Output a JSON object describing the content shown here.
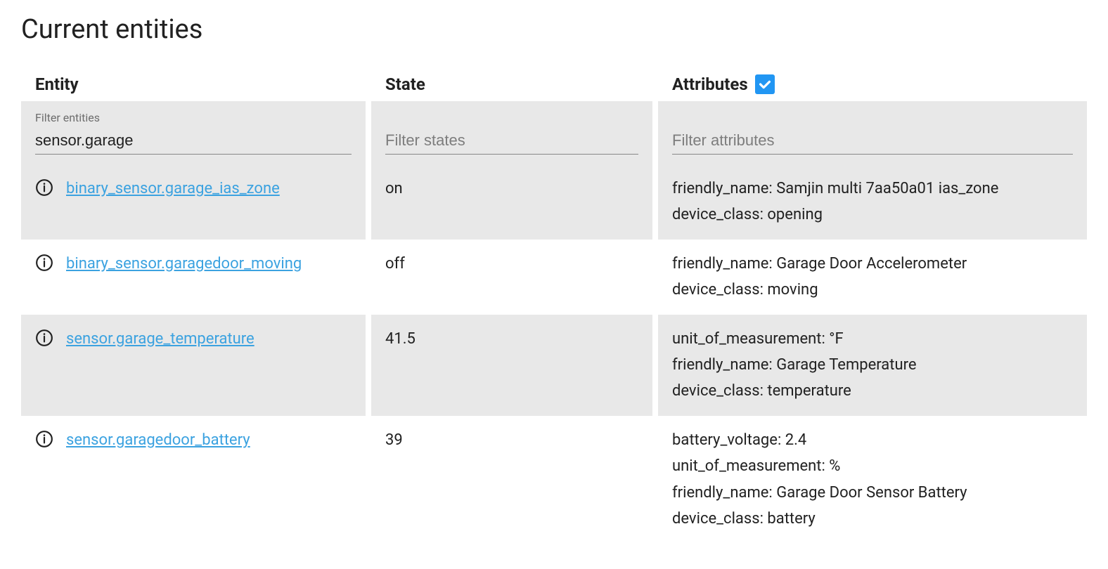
{
  "title": "Current entities",
  "headers": {
    "entity": "Entity",
    "state": "State",
    "attributes": "Attributes"
  },
  "filters": {
    "entity_label": "Filter entities",
    "entity_value": "sensor.garage",
    "state_placeholder": "Filter states",
    "attributes_placeholder": "Filter attributes",
    "attributes_checked": true
  },
  "rows": [
    {
      "entity": "binary_sensor.garage_ias_zone",
      "state": "on",
      "attributes": [
        "friendly_name: Samjin multi 7aa50a01 ias_zone",
        "device_class: opening"
      ]
    },
    {
      "entity": "binary_sensor.garagedoor_moving",
      "state": "off",
      "attributes": [
        "friendly_name: Garage Door Accelerometer",
        "device_class: moving"
      ]
    },
    {
      "entity": "sensor.garage_temperature",
      "state": "41.5",
      "attributes": [
        "unit_of_measurement: °F",
        "friendly_name: Garage Temperature",
        "device_class: temperature"
      ]
    },
    {
      "entity": "sensor.garagedoor_battery",
      "state": "39",
      "attributes": [
        "battery_voltage: 2.4",
        "unit_of_measurement: %",
        "friendly_name: Garage Door Sensor Battery",
        "device_class: battery"
      ]
    }
  ]
}
